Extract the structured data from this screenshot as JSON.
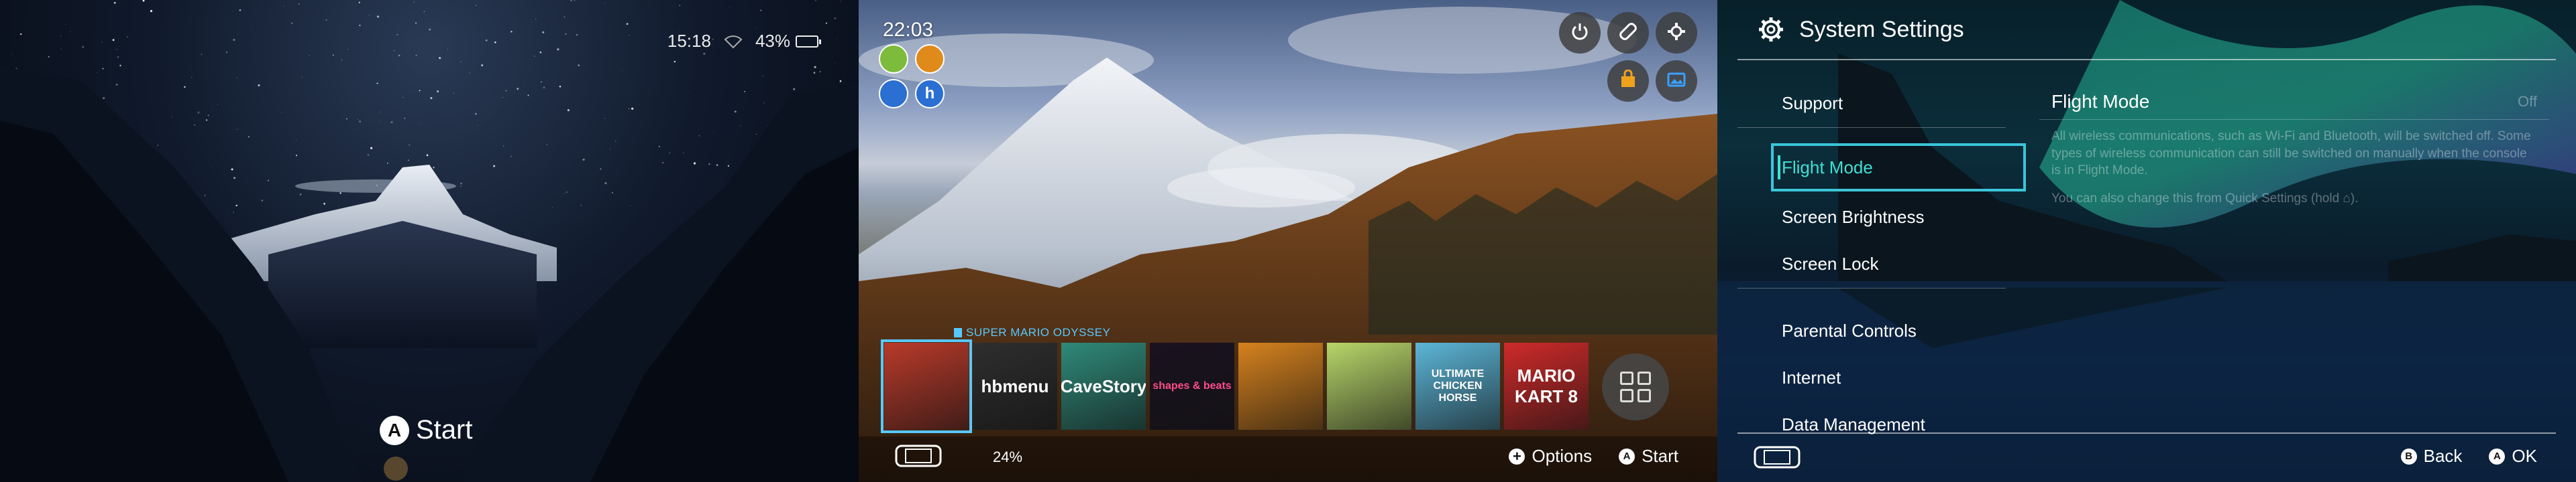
{
  "lockscreen": {
    "time": "15:18",
    "battery": {
      "percent": "43%",
      "level": 0.43
    },
    "start_button_glyph": "A",
    "start_label": "Start",
    "icons": [
      "wifi-icon",
      "battery-icon",
      "a-button-icon"
    ]
  },
  "home": {
    "time": "22:03",
    "users": [
      {
        "letter": "",
        "color": "#7dbb3c"
      },
      {
        "letter": "",
        "color": "#e08a1c"
      },
      {
        "letter": "",
        "color": "#2a6fd1"
      },
      {
        "letter": "h",
        "color": "#2a6fd1"
      }
    ],
    "top_buttons": [
      "power-icon",
      "controller-icon",
      "gear-icon",
      "",
      "shop-icon",
      "album-icon"
    ],
    "selected_game_title": "SUPER MARIO ODYSSEY",
    "tiles": [
      {
        "label": "",
        "bg": "#b93a2a",
        "fg": "#fff"
      },
      {
        "label": "hbmenu",
        "bg": "#2e2e2e",
        "fg": "#fff"
      },
      {
        "label": "CaveStory",
        "bg": "#2f8a7a",
        "fg": "#fff"
      },
      {
        "label": "shapes & beats",
        "bg": "#1a1220",
        "fg": "#ff4d8a"
      },
      {
        "label": "",
        "bg": "#d6821e",
        "fg": "#fff"
      },
      {
        "label": "",
        "bg": "#b7d66a",
        "fg": "#fff"
      },
      {
        "label": "ULTIMATE CHICKEN HORSE",
        "bg": "#5cb6d8",
        "fg": "#fff"
      },
      {
        "label": "MARIO KART 8",
        "bg": "#cf2a2a",
        "fg": "#fff"
      }
    ],
    "battery": "24%",
    "hints": [
      {
        "glyph": "+",
        "label": "Options"
      },
      {
        "glyph": "A",
        "label": "Start"
      }
    ]
  },
  "settings": {
    "title": "System Settings",
    "menu": [
      {
        "label": "Support",
        "active": false
      },
      {
        "label": "Flight Mode",
        "active": true
      },
      {
        "label": "Screen Brightness",
        "active": false
      },
      {
        "label": "Screen Lock",
        "active": false
      },
      {
        "label": "Parental Controls",
        "active": false
      },
      {
        "label": "Internet",
        "active": false
      },
      {
        "label": "Data Management",
        "active": false
      }
    ],
    "detail": {
      "title": "Flight Mode",
      "value": "Off",
      "description": "All wireless communications, such as Wi-Fi and Bluetooth, will be switched off. Some types of wireless communication can still be switched on manually when the console is in Flight Mode.",
      "note": "You can also change this from Quick Settings (hold ⌂)."
    },
    "hints": [
      {
        "glyph": "B",
        "label": "Back"
      },
      {
        "glyph": "A",
        "label": "OK"
      }
    ]
  }
}
